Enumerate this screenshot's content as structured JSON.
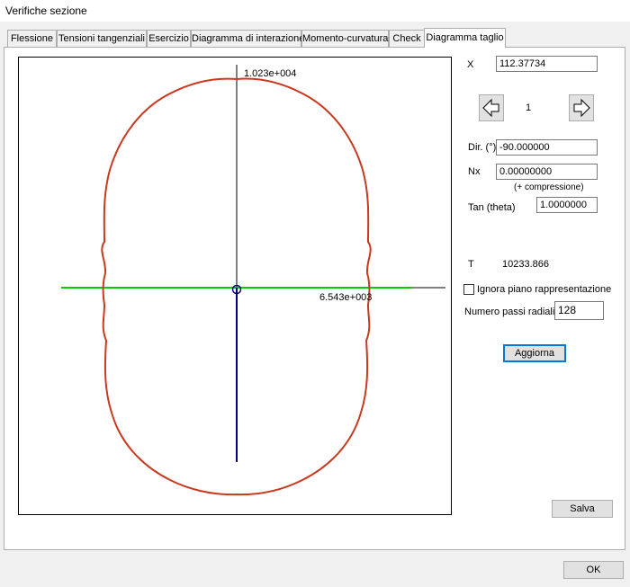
{
  "window": {
    "title": "Verifiche sezione"
  },
  "tabs": [
    {
      "label": "Flessione"
    },
    {
      "label": "Tensioni tangenziali"
    },
    {
      "label": "Esercizio"
    },
    {
      "label": "Diagramma di interazione"
    },
    {
      "label": "Momento-curvatura"
    },
    {
      "label": "Check"
    },
    {
      "label": "Diagramma taglio",
      "active": true
    }
  ],
  "plot": {
    "top_label": "1.023e+004",
    "right_label": "6.543e+003",
    "curve_color": "#c8391f",
    "horizontal_axis_color": "#00d000",
    "vertical_axis_color": "#000080"
  },
  "panel": {
    "x_label": "X",
    "x_value": "112.37734",
    "step_index": "1",
    "dir_label": "Dir. (°)",
    "dir_value": "-90.000000",
    "nx_label": "Nx",
    "nx_value": "0.00000000",
    "nx_note": "(+ compressione)",
    "tan_label": "Tan (theta)",
    "tan_value": "1.0000000",
    "t_label": "T",
    "t_value": "10233.866",
    "ignore_label": "Ignora piano rappresentazione",
    "ignore_checked": false,
    "steps_label": "Numero passi radiali",
    "steps_value": "128",
    "update_button": "Aggiorna",
    "save_button": "Salva"
  },
  "footer": {
    "ok_button": "OK"
  }
}
